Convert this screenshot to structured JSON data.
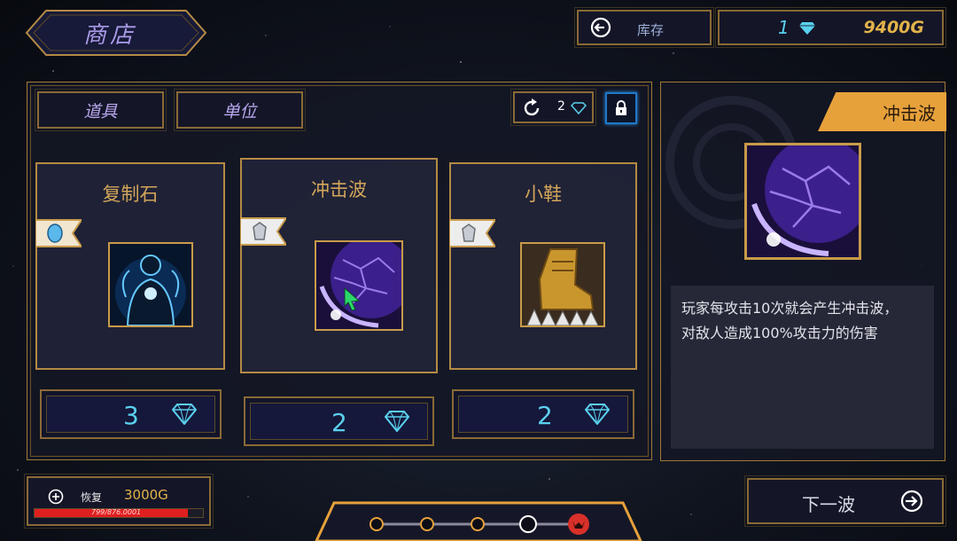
{
  "header": {
    "title": "商店",
    "inventory_label": "库存",
    "gem_count": "1",
    "gold": "9400G"
  },
  "tabs": [
    {
      "label": "道具"
    },
    {
      "label": "单位"
    }
  ],
  "refresh": {
    "cost": "2"
  },
  "items": [
    {
      "name": "复制石",
      "price": "3",
      "tier": "blue",
      "icon": "ghost-figure-icon"
    },
    {
      "name": "冲击波",
      "price": "2",
      "tier": "silver",
      "icon": "shockwave-icon"
    },
    {
      "name": "小鞋",
      "price": "2",
      "tier": "silver",
      "icon": "boot-icon"
    }
  ],
  "detail": {
    "name": "冲击波",
    "description_line1": "玩家每攻击10次就会产生冲击波，",
    "description_line2": "对敌人造成100%攻击力的伤害"
  },
  "health": {
    "label": "恢复",
    "cost": "3000G",
    "hp_text": "799/876.0001",
    "hp_fraction": 0.91
  },
  "next_wave": {
    "label": "下一波"
  },
  "wave_progress": {
    "total_nodes": 5,
    "current": 4
  },
  "colors": {
    "gold": "#c89b4a",
    "gem": "#5ad0ee",
    "detail_tag": "#e6a13b",
    "hp_bar": "#e01f1f"
  }
}
